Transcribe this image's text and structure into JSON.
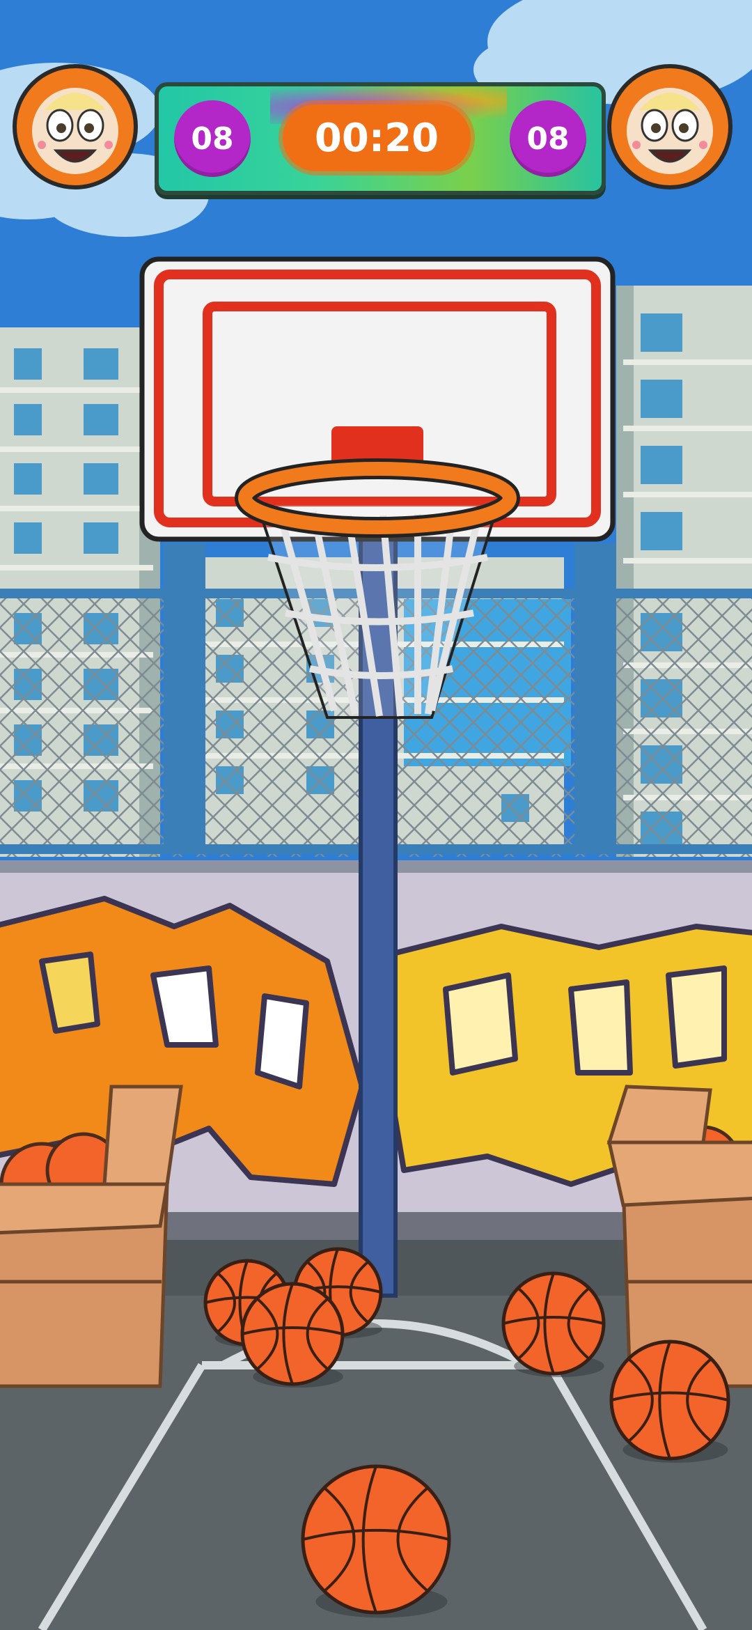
{
  "hud": {
    "player_score": "08",
    "timer": "00:20",
    "opponent_score": "08"
  },
  "avatars": {
    "player": "baby-face-avatar",
    "opponent": "baby-face-avatar"
  },
  "colors": {
    "sky": "#2f7ed6",
    "hud_bg": "#28c39f",
    "score_badge": "#b326c8",
    "timer_badge": "#f06f15",
    "backboard_red": "#e2301f",
    "rim": "#f07a1c",
    "ball": "#f2642a",
    "court": "#5c6468"
  },
  "scene": {
    "balls_on_court": 6,
    "boxes": [
      "left-ball-box",
      "right-ball-box"
    ]
  }
}
